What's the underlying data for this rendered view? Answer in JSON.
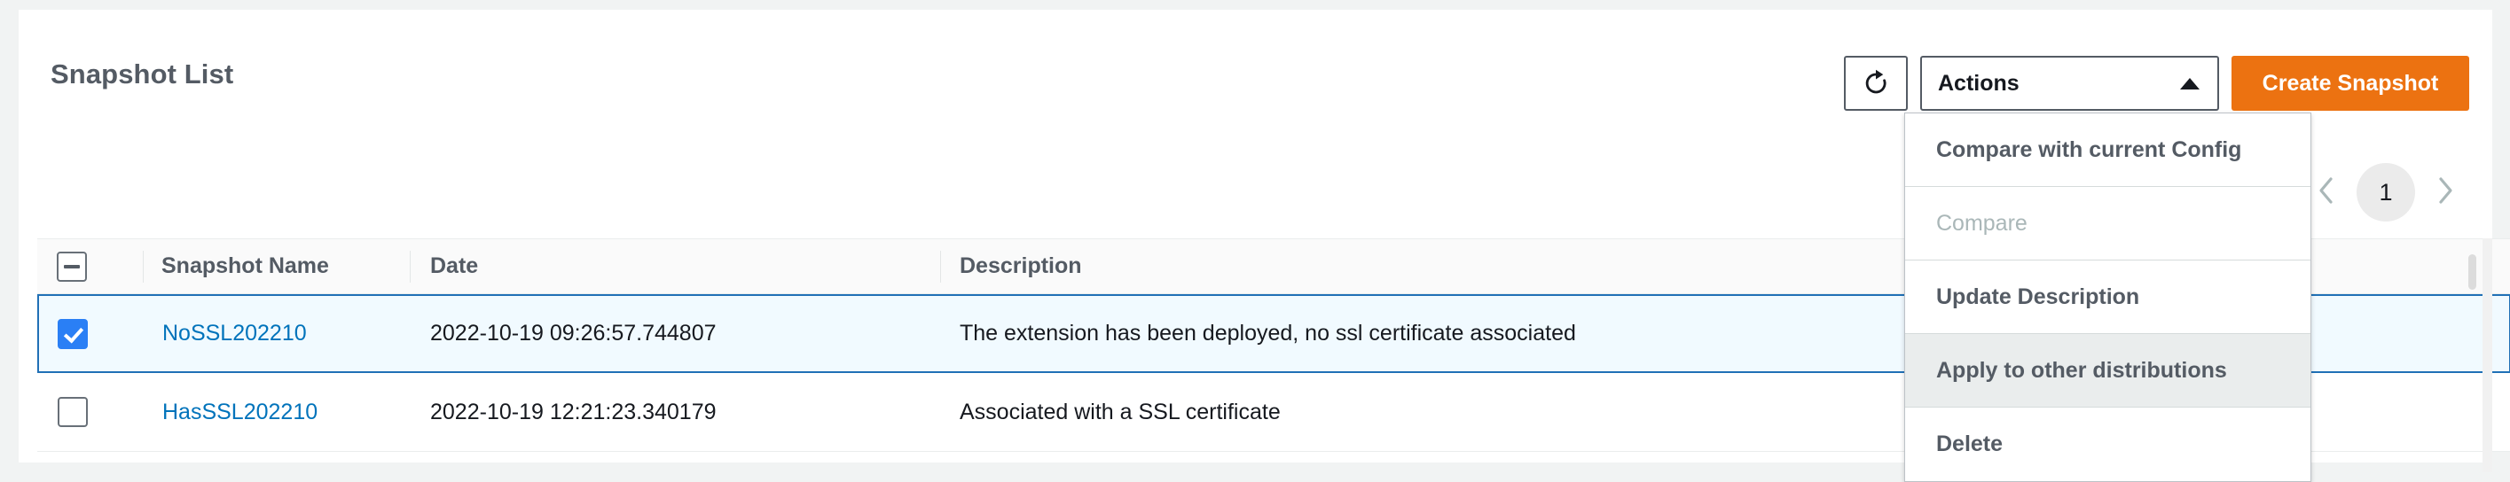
{
  "page": {
    "title": "Snapshot List"
  },
  "toolbar": {
    "refresh_icon": "refresh-icon",
    "actions_label": "Actions",
    "actions_caret": "caret-up-icon",
    "create_label": "Create Snapshot",
    "accent_color": "#ec7211"
  },
  "dropdown": {
    "open": true,
    "items": [
      {
        "label": "Compare with current Config",
        "state": "enabled"
      },
      {
        "label": "Compare",
        "state": "disabled"
      },
      {
        "label": "Update Description",
        "state": "enabled"
      },
      {
        "label": "Apply to other distributions",
        "state": "hovered"
      },
      {
        "label": "Delete",
        "state": "enabled"
      }
    ]
  },
  "pagination": {
    "prev_icon": "chevron-left-icon",
    "next_icon": "chevron-right-icon",
    "current_page": "1"
  },
  "table": {
    "select_all_state": "indeterminate",
    "columns": [
      {
        "key": "name",
        "label": "Snapshot Name"
      },
      {
        "key": "date",
        "label": "Date"
      },
      {
        "key": "description",
        "label": "Description"
      }
    ],
    "rows": [
      {
        "checked": true,
        "selected": true,
        "name": "NoSSL202210",
        "date": "2022-10-19 09:26:57.744807",
        "description": "The extension has been deployed, no ssl certificate associated"
      },
      {
        "checked": false,
        "selected": false,
        "name": "HasSSL202210",
        "date": "2022-10-19 12:21:23.340179",
        "description": "Associated with a SSL certificate"
      }
    ]
  },
  "colors": {
    "page_background": "#f1f3f3",
    "card_background": "#ffffff",
    "selected_row_background": "#f1faff",
    "selected_row_border": "#2070b6",
    "link": "#0073bb",
    "checkbox_checked": "#2a7ff5",
    "header_background": "#fafafa"
  }
}
